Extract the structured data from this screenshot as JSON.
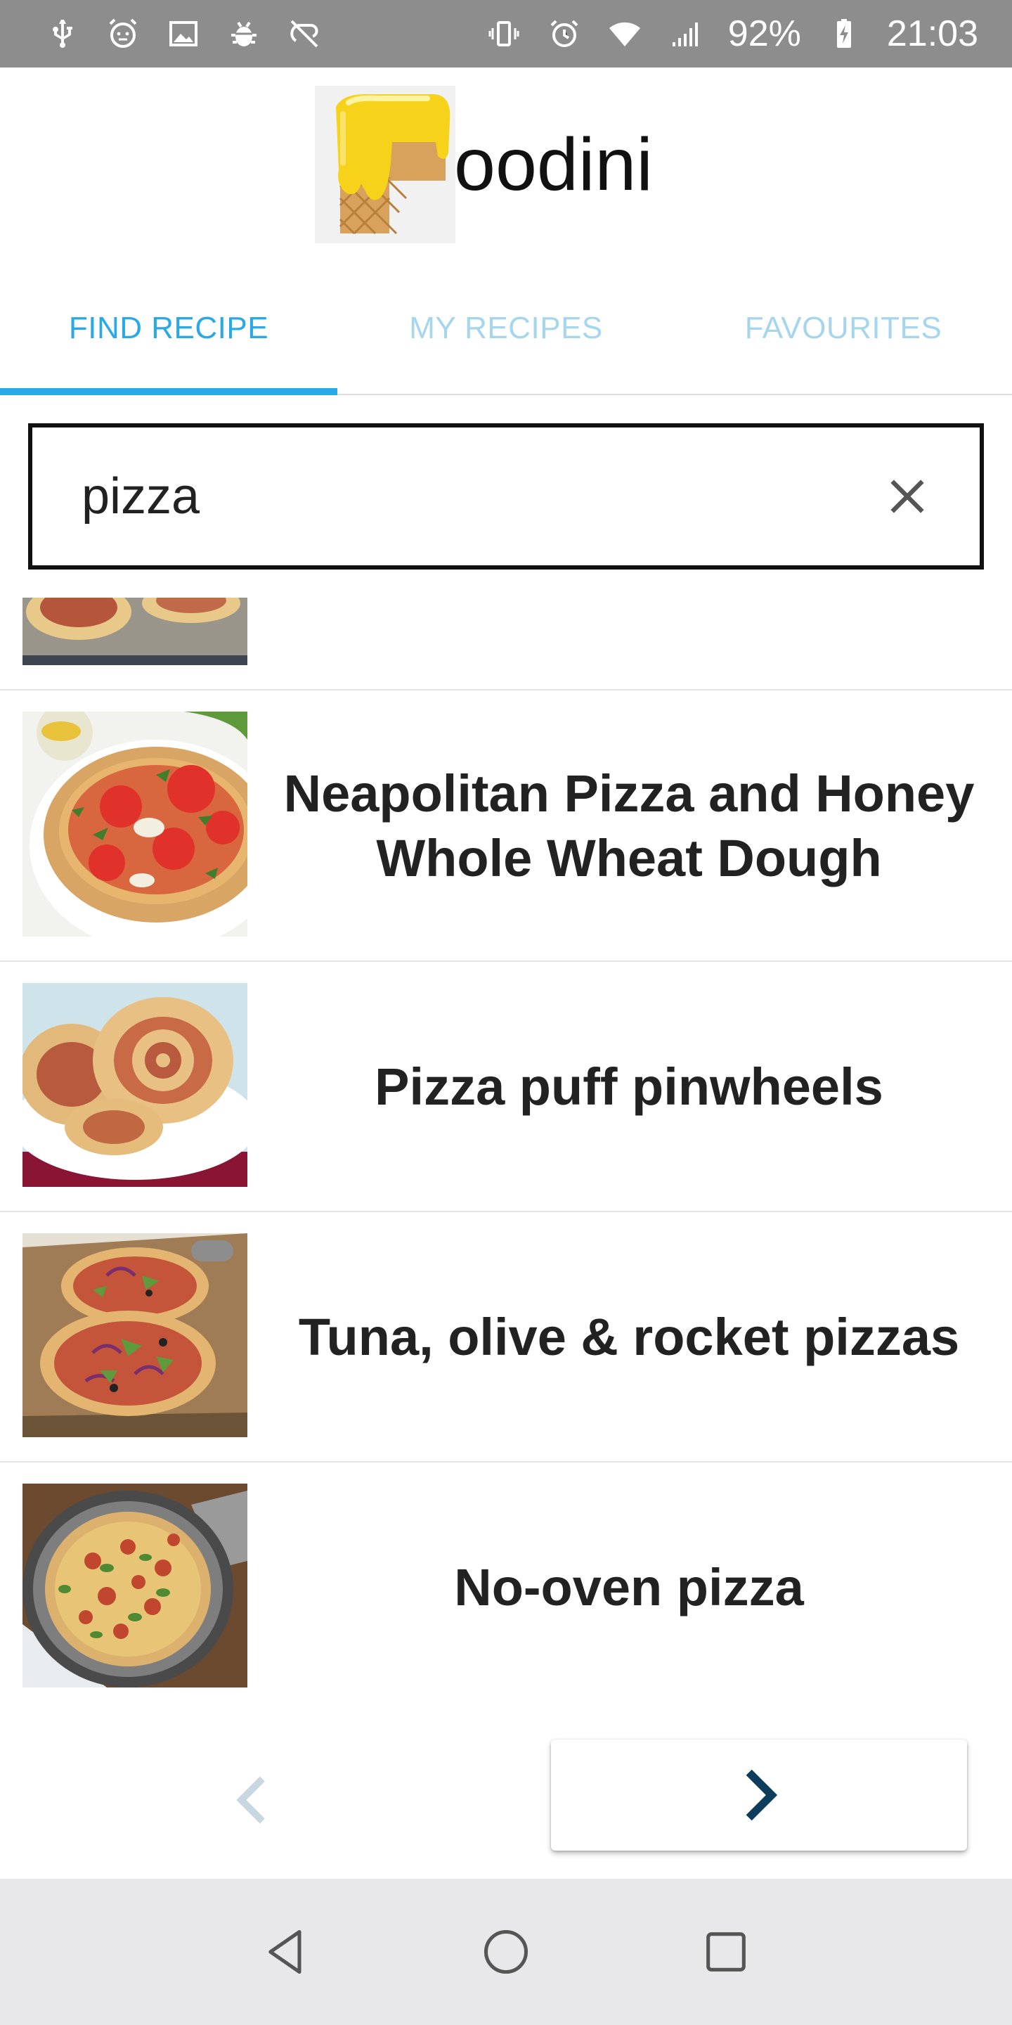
{
  "status_bar": {
    "battery": "92%",
    "time": "21:03",
    "icons_left": [
      "usb-icon",
      "alarm-face-icon",
      "image-icon",
      "android-debug-icon",
      "sync-off-icon"
    ],
    "icons_right": [
      "vibrate-icon",
      "alarm-icon",
      "wifi-icon",
      "signal-icon",
      "battery-charging-icon"
    ]
  },
  "header": {
    "app_name": "oodini"
  },
  "tabs": [
    {
      "label": "FIND RECIPE",
      "active": true
    },
    {
      "label": "MY RECIPES",
      "active": false
    },
    {
      "label": "FAVOURITES",
      "active": false
    }
  ],
  "search": {
    "value": "pizza",
    "placeholder": ""
  },
  "results": [
    {
      "title": ""
    },
    {
      "title": "Neapolitan Pizza and Honey Whole Wheat Dough"
    },
    {
      "title": "Pizza puff pinwheels"
    },
    {
      "title": "Tuna, olive & rocket pizzas"
    },
    {
      "title": "No-oven pizza"
    }
  ],
  "colors": {
    "accent": "#29a9e6",
    "tab_inactive": "#a6d6ee",
    "next_arrow": "#0d3d5c",
    "prev_arrow_disabled": "#c8d8e0"
  }
}
